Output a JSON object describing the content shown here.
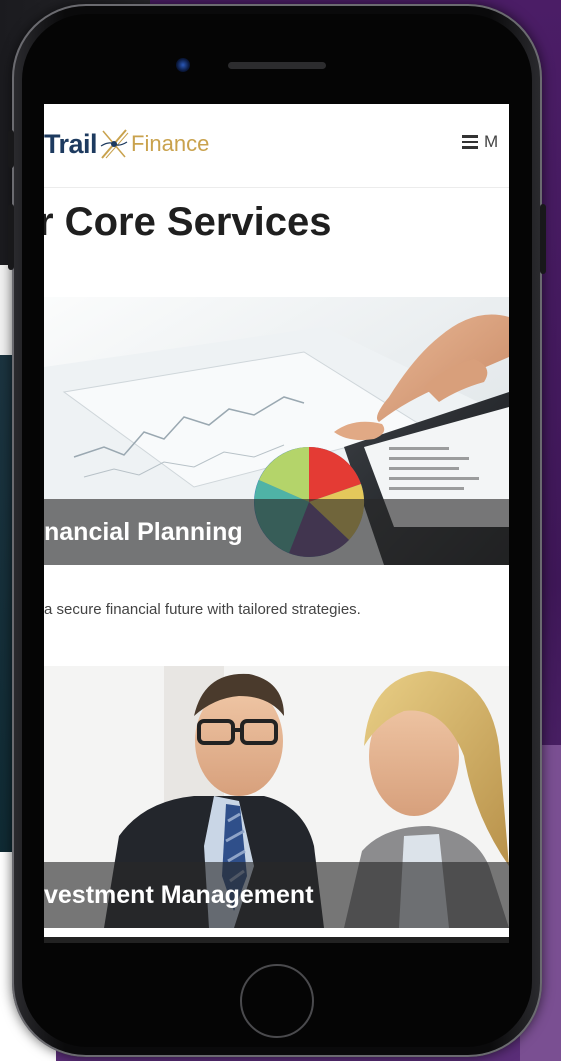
{
  "site": {
    "logo_primary": "Trail",
    "logo_secondary": "Finance",
    "menu_label": "M"
  },
  "main": {
    "section_title": "r Core Services",
    "services": [
      {
        "title": "nancial Planning",
        "description": "a secure financial future with tailored strategies."
      },
      {
        "title": "vestment Management"
      }
    ]
  },
  "colors": {
    "background": "#3e1757",
    "logo_primary": "#1d3a5f",
    "logo_secondary": "#c9a24d",
    "caption_overlay": "#282828"
  },
  "icons": [
    "hamburger-menu-icon",
    "logo-x-icon",
    "front-camera-icon",
    "home-button-icon"
  ]
}
